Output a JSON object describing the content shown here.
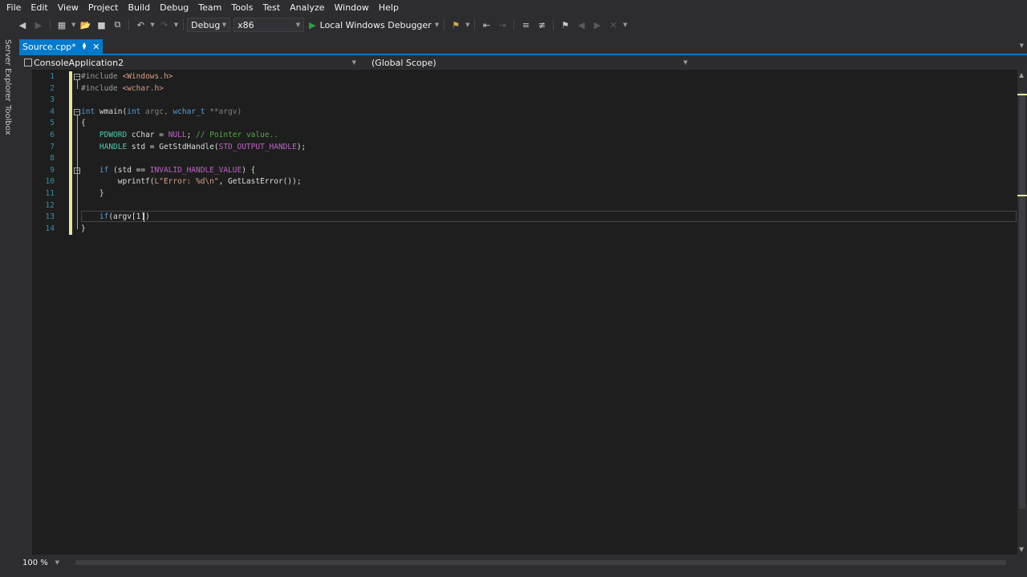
{
  "menu": [
    "File",
    "Edit",
    "View",
    "Project",
    "Build",
    "Debug",
    "Team",
    "Tools",
    "Test",
    "Analyze",
    "Window",
    "Help"
  ],
  "toolbar": {
    "config": "Debug",
    "platform": "x86",
    "debugger": "Local Windows Debugger"
  },
  "rail": {
    "server_explorer": "Server Explorer",
    "toolbox": "Toolbox"
  },
  "tab": {
    "title": "Source.cpp*"
  },
  "nav": {
    "project": "ConsoleApplication2",
    "scope": "(Global Scope)"
  },
  "editor": {
    "line_numbers": [
      "1",
      "2",
      "3",
      "4",
      "5",
      "6",
      "7",
      "8",
      "9",
      "10",
      "11",
      "12",
      "13",
      "14"
    ],
    "lines": [
      [
        {
          "t": "#include ",
          "c": "pp"
        },
        {
          "t": "<Windows.h>",
          "c": "str"
        }
      ],
      [
        {
          "t": "#include ",
          "c": "pp"
        },
        {
          "t": "<wchar.h>",
          "c": "str"
        }
      ],
      [],
      [
        {
          "t": "int",
          "c": "kw"
        },
        {
          "t": " wmain(",
          "c": ""
        },
        {
          "t": "int",
          "c": "kw"
        },
        {
          "t": " argc, ",
          "c": "pa"
        },
        {
          "t": "wchar_t",
          "c": "kw"
        },
        {
          "t": " **argv)",
          "c": "pa"
        }
      ],
      [
        {
          "t": "{",
          "c": ""
        }
      ],
      [
        {
          "t": "    PDWORD",
          "c": "ty"
        },
        {
          "t": " cChar = ",
          "c": ""
        },
        {
          "t": "NULL",
          "c": "mc"
        },
        {
          "t": "; ",
          "c": ""
        },
        {
          "t": "// Pointer value..",
          "c": "cm"
        }
      ],
      [
        {
          "t": "    HANDLE",
          "c": "ty"
        },
        {
          "t": " std = GetStdHandle(",
          "c": ""
        },
        {
          "t": "STD_OUTPUT_HANDLE",
          "c": "mc"
        },
        {
          "t": ");",
          "c": ""
        }
      ],
      [],
      [
        {
          "t": "    if",
          "c": "kw"
        },
        {
          "t": " (std == ",
          "c": ""
        },
        {
          "t": "INVALID_HANDLE_VALUE",
          "c": "mc"
        },
        {
          "t": ") {",
          "c": ""
        }
      ],
      [
        {
          "t": "        wprintf(",
          "c": ""
        },
        {
          "t": "L\"Error: %d\\n\"",
          "c": "str"
        },
        {
          "t": ", GetLastError());",
          "c": ""
        }
      ],
      [
        {
          "t": "    }",
          "c": ""
        }
      ],
      [],
      [
        {
          "t": "    if",
          "c": "kw"
        },
        {
          "t": "(argv[1])",
          "c": ""
        }
      ],
      [
        {
          "t": "}",
          "c": ""
        }
      ]
    ]
  },
  "zoom": "100 %"
}
